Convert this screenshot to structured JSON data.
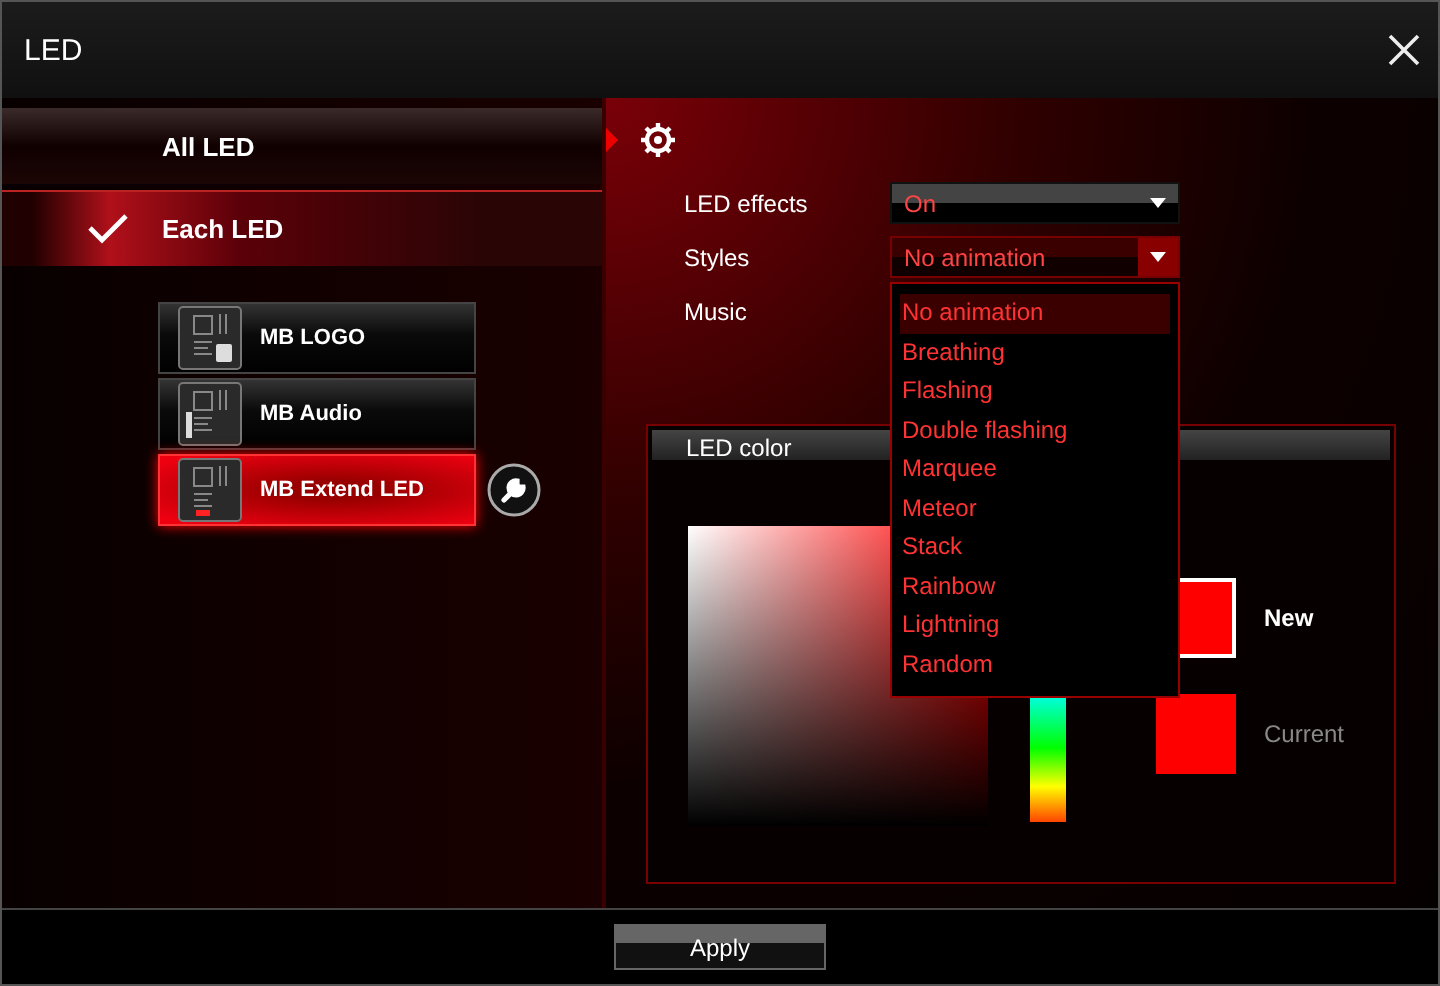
{
  "window": {
    "title": "LED"
  },
  "modes": [
    {
      "label": "All LED",
      "selected": false
    },
    {
      "label": "Each LED",
      "selected": true
    }
  ],
  "devices": [
    {
      "label": "MB LOGO",
      "kind": "logo",
      "selected": false
    },
    {
      "label": "MB Audio",
      "kind": "audio",
      "selected": false
    },
    {
      "label": "MB Extend LED",
      "kind": "extend",
      "selected": true
    }
  ],
  "settings": {
    "effects": {
      "label": "LED effects",
      "value": "On"
    },
    "styles": {
      "label": "Styles",
      "value": "No animation",
      "expanded": true,
      "options": [
        {
          "label": "No animation",
          "selected": true
        },
        {
          "label": "Breathing",
          "selected": false
        },
        {
          "label": "Flashing",
          "selected": false
        },
        {
          "label": "Double flashing",
          "selected": false
        },
        {
          "label": "Marquee",
          "selected": false
        },
        {
          "label": "Meteor",
          "selected": false
        },
        {
          "label": "Stack",
          "selected": false
        },
        {
          "label": "Rainbow",
          "selected": false
        },
        {
          "label": "Lightning",
          "selected": false
        },
        {
          "label": "Random",
          "selected": false
        }
      ]
    },
    "music": {
      "label": "Music"
    }
  },
  "led_color": {
    "title": "LED color",
    "new_label": "New",
    "current_label": "Current"
  },
  "apply_button": "Apply"
}
